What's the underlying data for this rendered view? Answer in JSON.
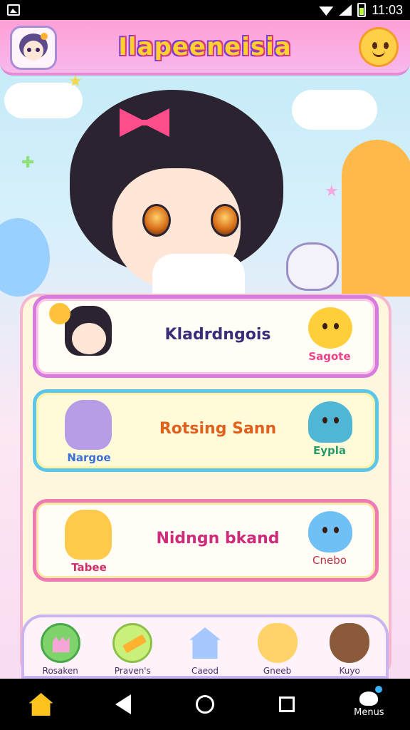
{
  "status_bar": {
    "time": "11:03"
  },
  "header": {
    "title": "Ilapeeneisia"
  },
  "cards": [
    {
      "title": "Kladrdngois",
      "right_label": "Sagote",
      "left_label": ""
    },
    {
      "title": "Rotsing Sann",
      "right_label": "Eypla",
      "left_label": "Nargoe"
    },
    {
      "title": "Nidngn bkand",
      "right_label": "Cnebo",
      "left_label": "Tabee"
    }
  ],
  "bottom_apps": [
    {
      "label": "Rosaken",
      "icon": "castle-icon"
    },
    {
      "label": "Praven's",
      "icon": "pencil-icon"
    },
    {
      "label": "Caeod",
      "icon": "house-icon"
    },
    {
      "label": "Gneeb",
      "icon": "cat-mascot-icon"
    },
    {
      "label": "Kuyo",
      "icon": "creature-icon"
    }
  ],
  "nav": {
    "menu_label": "Menus"
  },
  "colors": {
    "header_pink": "#ff9fd6",
    "title_yellow": "#ffd12f",
    "card1_border": "#d77be0",
    "card2_border": "#5cc6ea",
    "card3_border": "#f07ab4"
  }
}
